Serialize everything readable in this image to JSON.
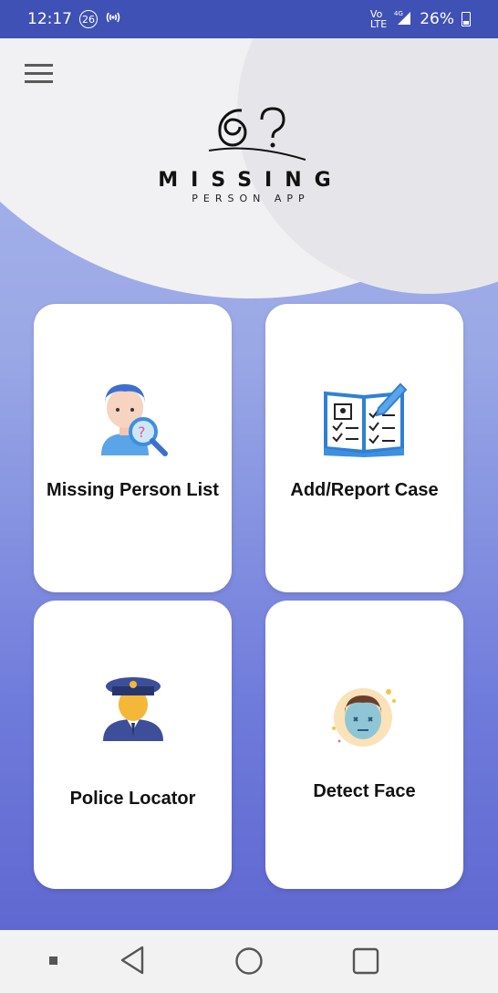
{
  "status": {
    "time": "12:17",
    "badge": "26",
    "volte": "Vo\nLTE",
    "network": "4G",
    "battery": "26%"
  },
  "logo": {
    "title": "MISSING",
    "subtitle": "PERSON APP"
  },
  "cards": [
    {
      "label": "Missing Person List",
      "icon": "missing-person-icon"
    },
    {
      "label": "Add/Report Case",
      "icon": "report-book-icon"
    },
    {
      "label": "Police Locator",
      "icon": "police-officer-icon"
    },
    {
      "label": "Detect Face",
      "icon": "face-detect-icon"
    }
  ],
  "colors": {
    "status_bar": "#3f51b5",
    "gradient_top": "#a7b4ea",
    "gradient_bottom": "#5f68d0",
    "icon_blue": "#3d8fe0"
  }
}
